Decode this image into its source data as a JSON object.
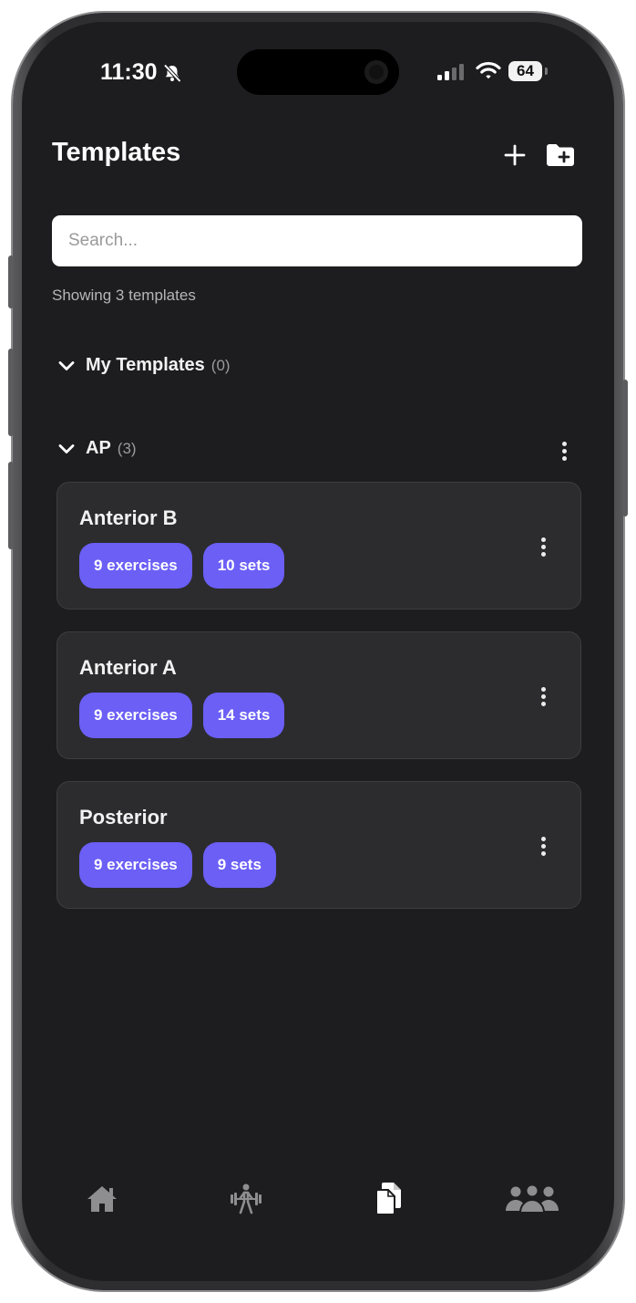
{
  "status_bar": {
    "time": "11:30",
    "battery": "64"
  },
  "header": {
    "title": "Templates"
  },
  "search": {
    "placeholder": "Search..."
  },
  "summary": "Showing 3 templates",
  "groups": [
    {
      "name": "My Templates",
      "count": "(0)"
    },
    {
      "name": "AP",
      "count": "(3)"
    }
  ],
  "templates": [
    {
      "title": "Anterior B",
      "exercises": "9 exercises",
      "sets": "10 sets"
    },
    {
      "title": "Anterior A",
      "exercises": "9 exercises",
      "sets": "14 sets"
    },
    {
      "title": "Posterior",
      "exercises": "9 exercises",
      "sets": "9 sets"
    }
  ],
  "icons": {
    "bell": "bell-slash-icon",
    "signal": "cellular-signal-icon",
    "wifi": "wifi-icon",
    "add": "plus-icon",
    "folder": "folder-plus-icon",
    "chevron": "chevron-down-icon",
    "more": "more-vertical-icon",
    "home": "home-icon",
    "workout": "weightlifter-icon",
    "templates": "documents-icon",
    "community": "people-icon"
  },
  "colors": {
    "background": "#1d1d1f",
    "card": "#2c2c2e",
    "chip": "#6b5ff6",
    "active_tab": "#ffffff",
    "inactive_tab": "#8e8e90"
  }
}
